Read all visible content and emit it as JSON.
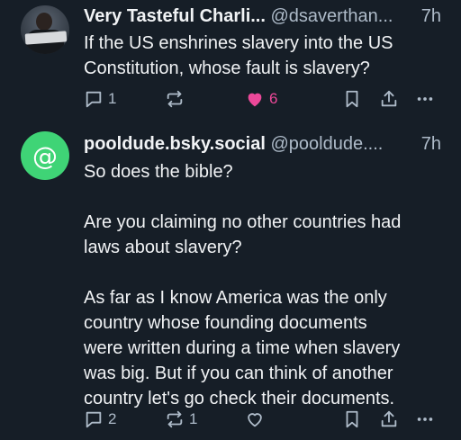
{
  "posts": [
    {
      "author_name": "Very Tasteful Charli...",
      "author_handle": "@dsaverthan...",
      "time": "7h",
      "body": "If the US enshrines slavery into the US\nConstitution, whose fault is slavery?",
      "avatar_icon": "profile-photo",
      "reply_count": "1",
      "repost_count": "",
      "like_count": "6",
      "liked": true
    },
    {
      "author_name": "pooldude.bsky.social",
      "author_handle": "@pooldude....",
      "time": "7h",
      "body": "So does the bible?\n\nAre you claiming no other countries had\nlaws about slavery?\n\nAs far as I know America was the only\ncountry whose founding documents\nwere written during a time when slavery\nwas big. But if you can think of another\ncountry let's go check their documents.",
      "avatar_icon": "at-sign",
      "avatar_glyph": "@",
      "reply_count": "2",
      "repost_count": "1",
      "like_count": "",
      "liked": false
    }
  ],
  "colors": {
    "background": "#161e27",
    "text": "#f1f3f5",
    "muted": "#aebbc9",
    "like_active": "#ec4899",
    "avatar_default": "#3fd476"
  }
}
